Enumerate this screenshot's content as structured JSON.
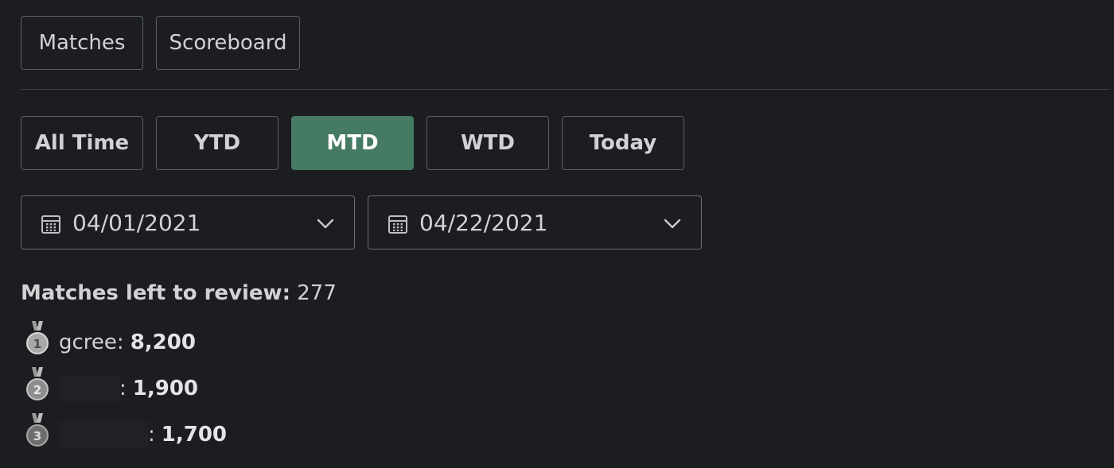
{
  "nav": {
    "matches_label": "Matches",
    "scoreboard_label": "Scoreboard"
  },
  "ranges": [
    {
      "label": "All Time",
      "active": false
    },
    {
      "label": "YTD",
      "active": false
    },
    {
      "label": "MTD",
      "active": true
    },
    {
      "label": "WTD",
      "active": false
    },
    {
      "label": "Today",
      "active": false
    }
  ],
  "date_range": {
    "start": "04/01/2021",
    "end": "04/22/2021",
    "icon": "calendar-icon",
    "dropdown_icon": "chevron-down-icon"
  },
  "review": {
    "label": "Matches left to review:",
    "count": "277"
  },
  "leaderboard": [
    {
      "rank": "1",
      "name": "gcree",
      "score": "8,200",
      "icon": "medal-1-icon"
    },
    {
      "rank": "2",
      "name": "",
      "score": "1,900",
      "icon": "medal-2-icon"
    },
    {
      "rank": "3",
      "name": "",
      "score": "1,700",
      "icon": "medal-3-icon"
    }
  ],
  "colors": {
    "background": "#1b1d21",
    "active_accent": "#457a63",
    "border": "#5b5e63",
    "text": "#d1d2d3"
  }
}
